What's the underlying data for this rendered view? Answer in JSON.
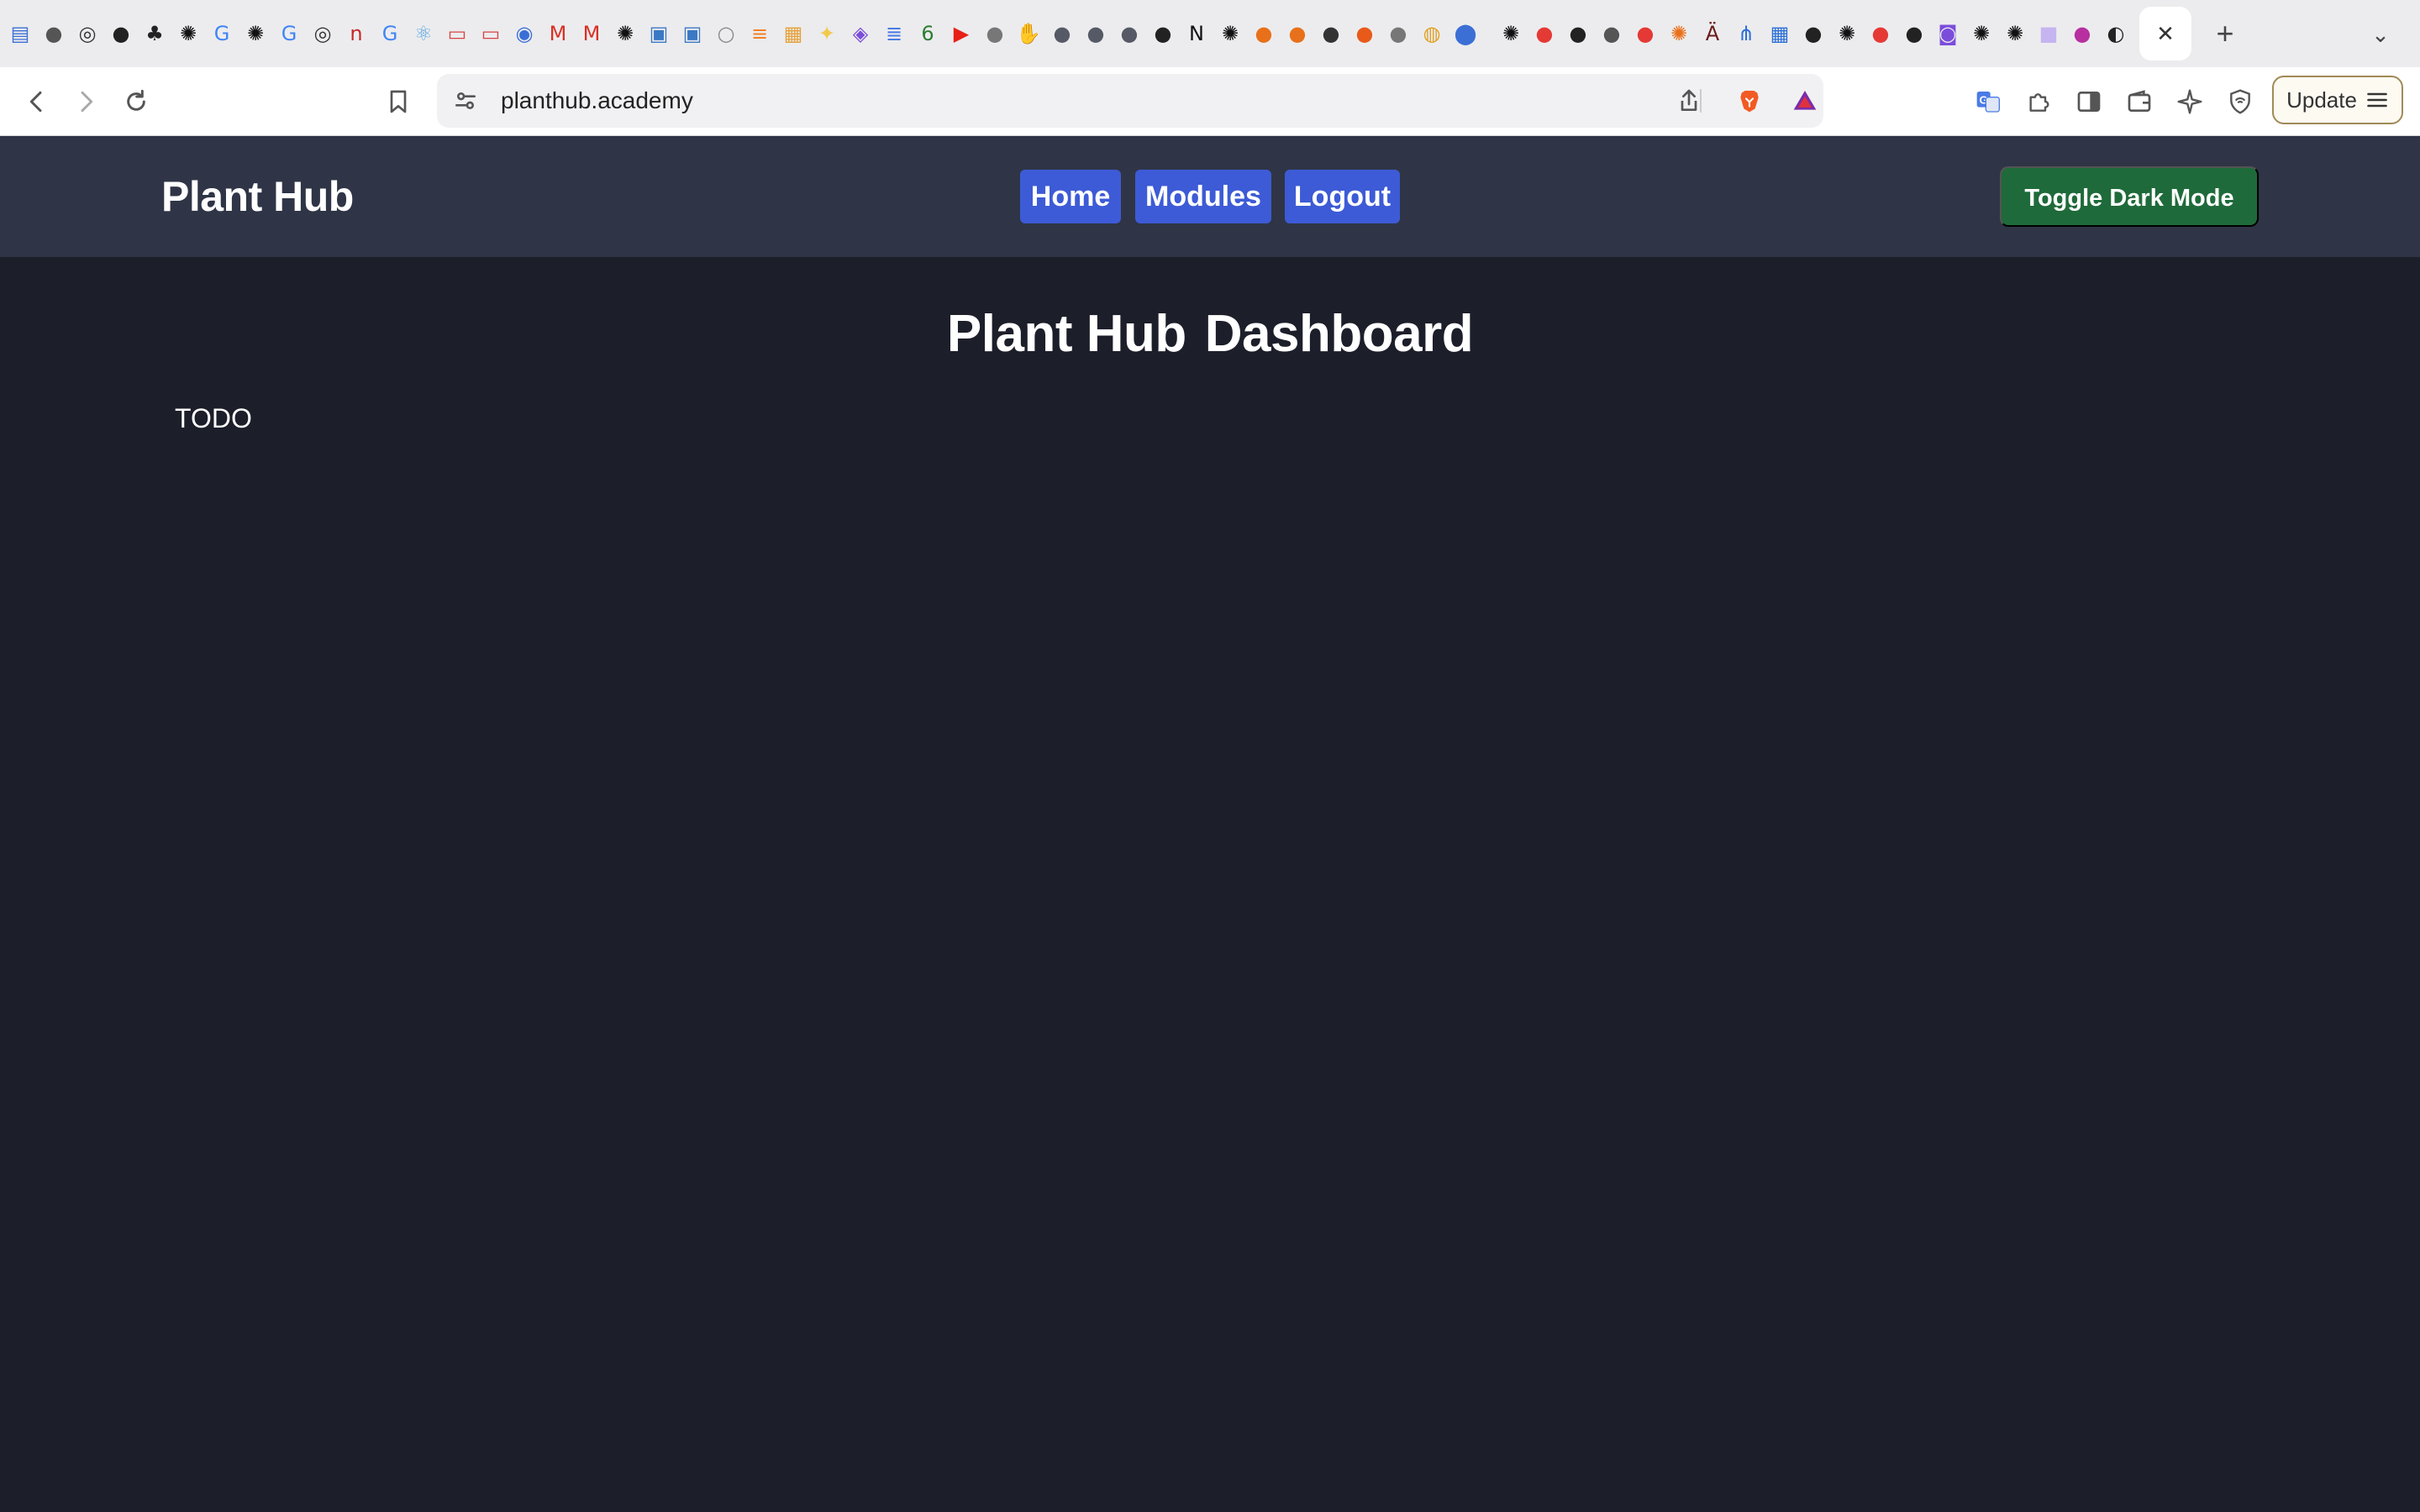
{
  "browser": {
    "url": "planthub.academy",
    "update_label": "Update",
    "close_tab_glyph": "✕",
    "new_tab_glyph": "+",
    "tab_menu_glyph": "⌄",
    "favicons": [
      {
        "icon": "reader-icon",
        "color": "#3b6fd6"
      },
      {
        "icon": "globe-icon",
        "color": "#555555"
      },
      {
        "icon": "swirl-icon",
        "color": "#333333"
      },
      {
        "icon": "github-icon",
        "color": "#222222"
      },
      {
        "icon": "tree-icon",
        "color": "#222222"
      },
      {
        "icon": "openai-icon",
        "color": "#111111"
      },
      {
        "icon": "google-icon",
        "color": "#4285f4"
      },
      {
        "icon": "openai-icon",
        "color": "#111111"
      },
      {
        "icon": "google-icon",
        "color": "#4285f4"
      },
      {
        "icon": "swirl-icon",
        "color": "#333333"
      },
      {
        "icon": "n-box-icon",
        "color": "#c62828"
      },
      {
        "icon": "google-icon",
        "color": "#4285f4"
      },
      {
        "icon": "react-icon",
        "color": "#61a8e0"
      },
      {
        "icon": "card-icon",
        "color": "#d84343"
      },
      {
        "icon": "card-icon",
        "color": "#d84343"
      },
      {
        "icon": "wp-icon",
        "color": "#3b6fd6"
      },
      {
        "icon": "gmail-icon",
        "color": "#d93025"
      },
      {
        "icon": "gmail-icon",
        "color": "#d93025"
      },
      {
        "icon": "openai-icon",
        "color": "#111111"
      },
      {
        "icon": "python-icon",
        "color": "#3b79c4"
      },
      {
        "icon": "python-icon",
        "color": "#3b79c4"
      },
      {
        "icon": "loader-icon",
        "color": "#888888"
      },
      {
        "icon": "stack-icon",
        "color": "#f48024"
      },
      {
        "icon": "box-icon",
        "color": "#e5a13a"
      },
      {
        "icon": "sparkle-icon",
        "color": "#f2c94c"
      },
      {
        "icon": "shield-icon",
        "color": "#7b4ddb"
      },
      {
        "icon": "docs-icon",
        "color": "#4a7be6"
      },
      {
        "icon": "six-icon",
        "color": "#2e7d32"
      },
      {
        "icon": "youtube-icon",
        "color": "#e62117"
      },
      {
        "icon": "circle-icon",
        "color": "#777777"
      },
      {
        "icon": "hand-icon",
        "color": "#999999"
      },
      {
        "icon": "circle-icon",
        "color": "#555a66"
      },
      {
        "icon": "circle-icon",
        "color": "#555a66"
      },
      {
        "icon": "circle-icon",
        "color": "#555a66"
      },
      {
        "icon": "github-icon",
        "color": "#222222"
      },
      {
        "icon": "notion-icon",
        "color": "#111111"
      },
      {
        "icon": "openai-icon",
        "color": "#111111"
      },
      {
        "icon": "orange-circle-icon",
        "color": "#e8701a"
      },
      {
        "icon": "orange-circle-icon",
        "color": "#e8701a"
      },
      {
        "icon": "lock-circle-icon",
        "color": "#333333"
      },
      {
        "icon": "orange-circle-icon",
        "color": "#e85a1a"
      },
      {
        "icon": "circle-icon",
        "color": "#777777"
      },
      {
        "icon": "chrome-icon",
        "color": "#e0a020"
      },
      {
        "icon": "pin-icon",
        "color": "#3b6fd6"
      },
      {
        "icon": "spacer",
        "color": "#ececee"
      },
      {
        "icon": "openai-icon",
        "color": "#111111"
      },
      {
        "icon": "red-dot-icon",
        "color": "#e53935"
      },
      {
        "icon": "github-icon",
        "color": "#222222"
      },
      {
        "icon": "globe-icon",
        "color": "#555555"
      },
      {
        "icon": "red-dot-icon",
        "color": "#e53935"
      },
      {
        "icon": "burst-icon",
        "color": "#e8701a"
      },
      {
        "icon": "atm-icon",
        "color": "#6b1a1a"
      },
      {
        "icon": "share-icon",
        "color": "#2b6fd6"
      },
      {
        "icon": "calendar-icon",
        "color": "#2b6fd6"
      },
      {
        "icon": "github-icon",
        "color": "#222222"
      },
      {
        "icon": "openai-icon",
        "color": "#111111"
      },
      {
        "icon": "red-dot-icon",
        "color": "#e53935"
      },
      {
        "icon": "github-icon",
        "color": "#222222"
      },
      {
        "icon": "bot-icon",
        "color": "#7b4ddb"
      },
      {
        "icon": "openai-icon",
        "color": "#111111"
      },
      {
        "icon": "openai-icon",
        "color": "#111111"
      },
      {
        "icon": "gradient-icon",
        "color": "#c6b4f0"
      },
      {
        "icon": "chat-icon",
        "color": "#b82fa0"
      },
      {
        "icon": "copilot-icon",
        "color": "#222222"
      }
    ]
  },
  "site": {
    "brand": "Plant Hub",
    "nav": [
      {
        "label": "Home"
      },
      {
        "label": "Modules"
      },
      {
        "label": "Logout"
      }
    ],
    "toggle_label": "Toggle Dark Mode",
    "colors": {
      "nav_bg": "#2f3546",
      "page_bg": "#1c1f2a",
      "link_bg": "#3d5bd6",
      "toggle_bg": "#1f6a3a"
    }
  },
  "main": {
    "title_part1": "Plant Hub",
    "title_part2": "Dashboard",
    "body_text": "TODO"
  }
}
